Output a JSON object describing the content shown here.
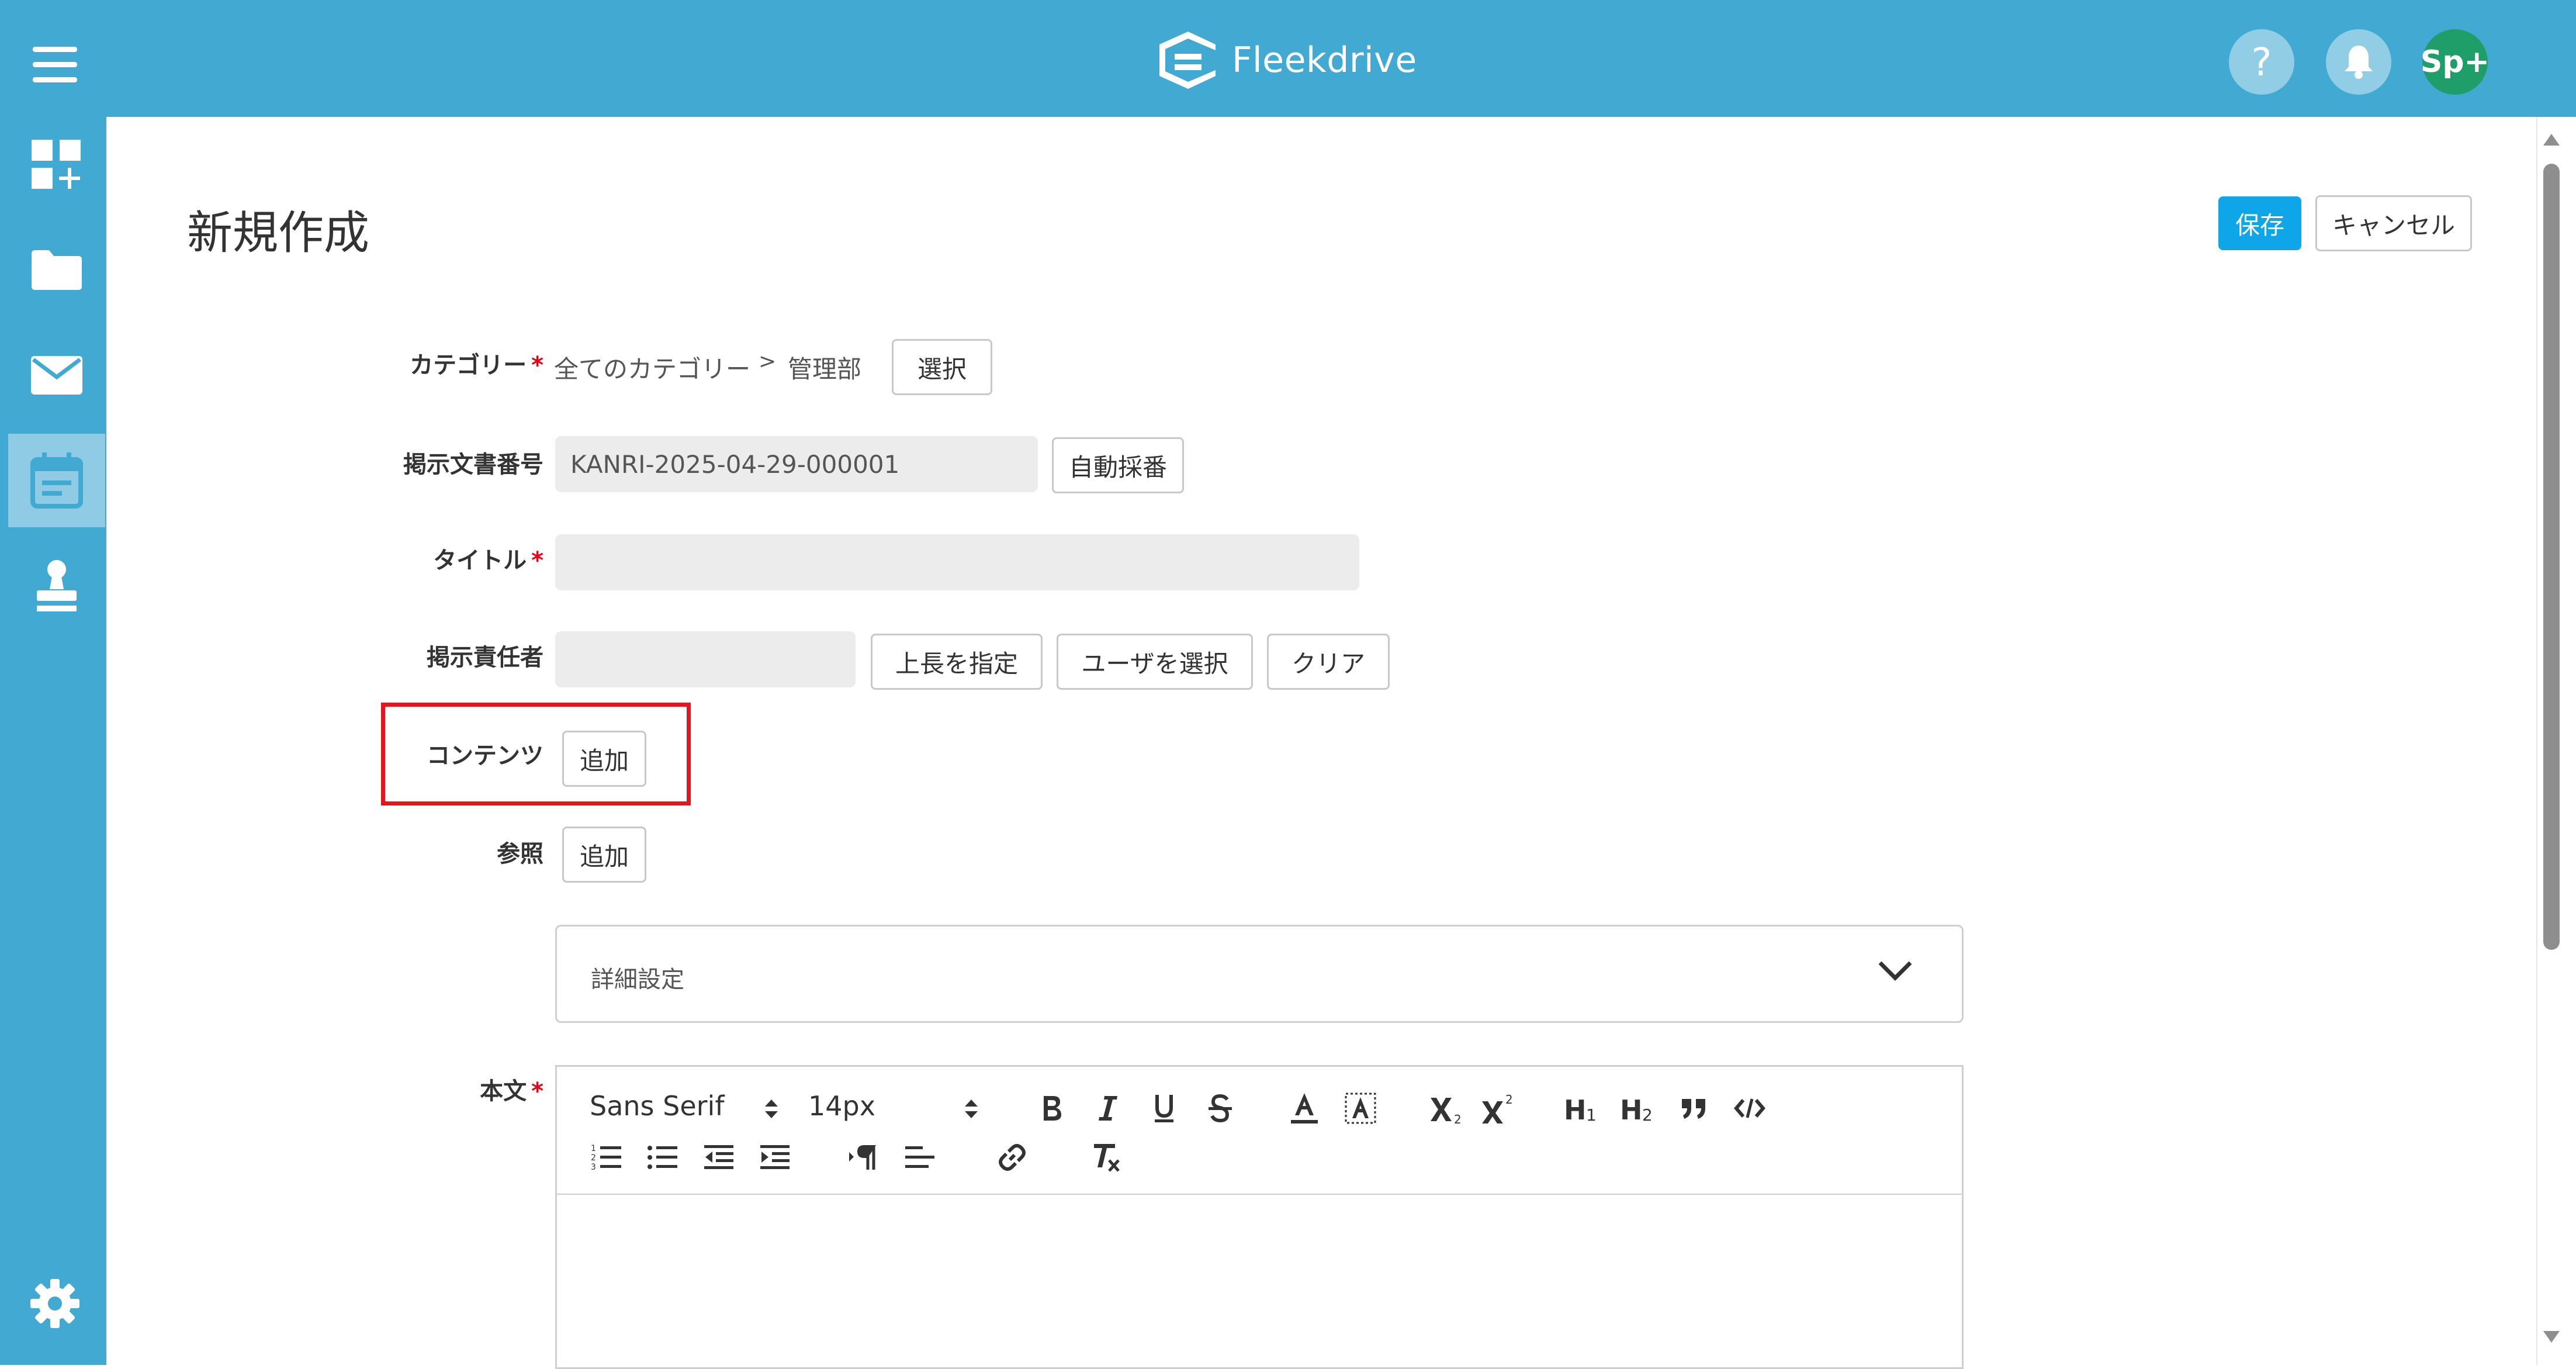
{
  "header": {
    "brand": "Fleekdrive",
    "help_label": "?",
    "avatar_label": "Sp+"
  },
  "colors": {
    "primary": "#42a9d2",
    "accent_button": "#0ea5e9",
    "required_mark": "#e60012",
    "highlight_box": "#e5141e",
    "avatar_bg": "#1f9e6a"
  },
  "sidebar": {
    "items": [
      {
        "icon": "dashboard-add-icon"
      },
      {
        "icon": "folder-icon"
      },
      {
        "icon": "mail-icon"
      },
      {
        "icon": "calendar-icon",
        "active": true
      },
      {
        "icon": "stamp-icon"
      }
    ],
    "settings_icon": "gear-icon"
  },
  "page": {
    "title": "新規作成",
    "save_label": "保存",
    "cancel_label": "キャンセル"
  },
  "form": {
    "category": {
      "label": "カテゴリー",
      "required": "*",
      "path_root": "全てのカテゴリー",
      "separator": ">",
      "path_leaf": "管理部",
      "select_label": "選択"
    },
    "doc_number": {
      "label": "掲示文書番号",
      "value": "KANRI-2025-04-29-000001",
      "auto_label": "自動採番"
    },
    "title": {
      "label": "タイトル",
      "required": "*",
      "value": ""
    },
    "owner": {
      "label": "掲示責任者",
      "value": "",
      "boss_label": "上長を指定",
      "user_label": "ユーザを選択",
      "clear_label": "クリア"
    },
    "contents": {
      "label": "コンテンツ",
      "add_label": "追加"
    },
    "reference": {
      "label": "参照",
      "add_label": "追加"
    },
    "advanced": {
      "label": "詳細設定"
    },
    "body": {
      "label": "本文",
      "required": "*",
      "font_family": "Sans Serif",
      "font_size": "14px",
      "value": ""
    }
  }
}
